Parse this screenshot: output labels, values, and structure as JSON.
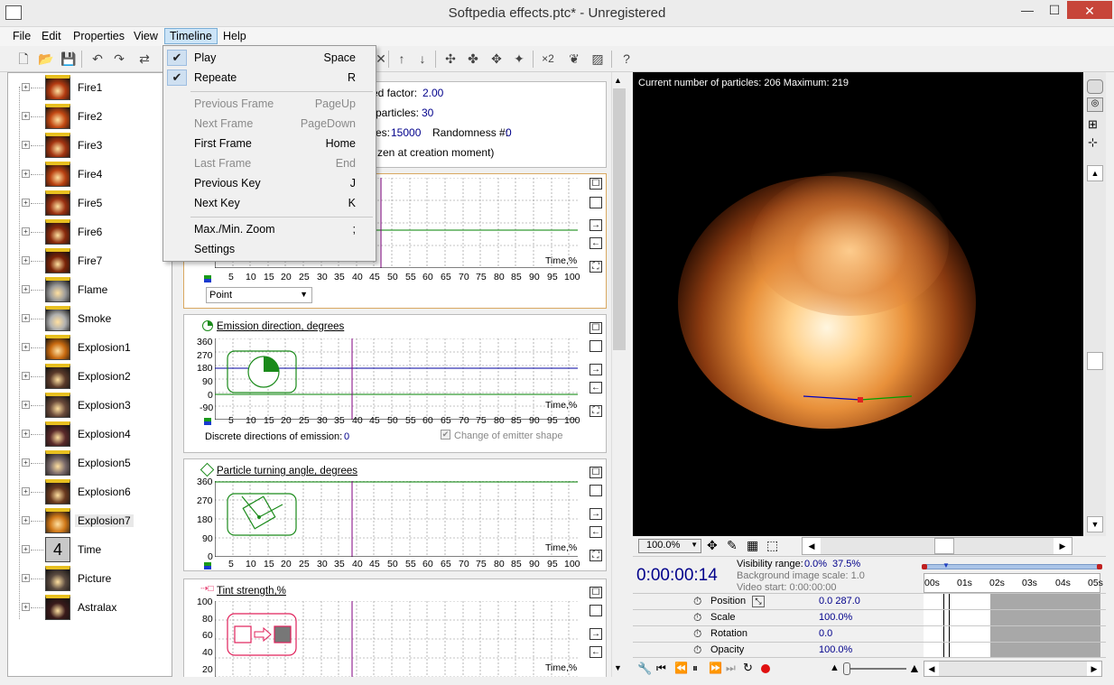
{
  "window": {
    "title": "Softpedia effects.ptc* - Unregistered",
    "minimize": "—",
    "maximize": "☐",
    "close": "✕"
  },
  "menubar": [
    "File",
    "Edit",
    "Properties",
    "View",
    "Timeline",
    "Help"
  ],
  "timeline_menu": [
    {
      "label": "Play",
      "shortcut": "Space",
      "checked": true
    },
    {
      "label": "Repeate",
      "shortcut": "R",
      "checked": true
    },
    {
      "label": "Previous Frame",
      "shortcut": "PageUp",
      "disabled": true
    },
    {
      "label": "Next Frame",
      "shortcut": "PageDown",
      "disabled": true
    },
    {
      "label": "First Frame",
      "shortcut": "Home"
    },
    {
      "label": "Last Frame",
      "shortcut": "End",
      "disabled": true
    },
    {
      "label": "Previous Key",
      "shortcut": "J"
    },
    {
      "label": "Next Key",
      "shortcut": "K"
    },
    {
      "label": "Max./Min. Zoom",
      "shortcut": ";"
    },
    {
      "label": "Settings",
      "shortcut": ""
    }
  ],
  "tree": [
    {
      "label": "Fire1",
      "color": "#b33a10"
    },
    {
      "label": "Fire2",
      "color": "#c24812"
    },
    {
      "label": "Fire3",
      "color": "#a33410"
    },
    {
      "label": "Fire4",
      "color": "#b84010"
    },
    {
      "label": "Fire5",
      "color": "#9a3010"
    },
    {
      "label": "Fire6",
      "color": "#8a2a0c"
    },
    {
      "label": "Fire7",
      "color": "#7a2408"
    },
    {
      "label": "Flame",
      "color": "#9a9a9a"
    },
    {
      "label": "Smoke",
      "color": "#b0b0b0"
    },
    {
      "label": "Explosion1",
      "color": "#c86a10"
    },
    {
      "label": "Explosion2",
      "color": "#5a3a2a"
    },
    {
      "label": "Explosion3",
      "color": "#6a4a3a"
    },
    {
      "label": "Explosion4",
      "color": "#5a2a2a"
    },
    {
      "label": "Explosion5",
      "color": "#7a6a6a"
    },
    {
      "label": "Explosion6",
      "color": "#6a3a20"
    },
    {
      "label": "Explosion7",
      "color": "#d07818"
    },
    {
      "label": "Time",
      "color": "#c8c8c8",
      "glyph": "4"
    },
    {
      "label": "Picture",
      "color": "#5a4a40"
    },
    {
      "label": "Astralax",
      "color": "#3a1a1a"
    }
  ],
  "props": {
    "speed_label": "ed factor:",
    "speed_value": "2.00",
    "particles_label": "particles:",
    "particles_value": "30",
    "es_label": "es:",
    "es_value": "15000",
    "randomness_label": "Randomness #:",
    "randomness_value": "0",
    "frozen_text": "zen at creation moment)"
  },
  "graph_x_ticks": [
    "5",
    "10",
    "15",
    "20",
    "25",
    "30",
    "35",
    "40",
    "45",
    "50",
    "55",
    "60",
    "65",
    "70",
    "75",
    "80",
    "85",
    "90",
    "95",
    "100"
  ],
  "graph_x_label": "Time,%",
  "shape_select": "Point",
  "emission": {
    "title": "Emission direction, degrees",
    "yticks": [
      "360",
      "270",
      "180",
      "90",
      "0",
      "-90"
    ],
    "discrete_label": "Discrete directions of emission:",
    "discrete_value": "0",
    "change_shape": "Change of emitter shape"
  },
  "turning": {
    "title": "Particle turning angle, degrees",
    "yticks": [
      "360",
      "270",
      "180",
      "90",
      "0"
    ]
  },
  "tint": {
    "title": "Tint strength,%",
    "yticks": [
      "100",
      "80",
      "60",
      "40",
      "20"
    ]
  },
  "view": {
    "info": "Current number of particles: 206    Maximum: 219",
    "zoom": "100.0%"
  },
  "timeline": {
    "time": "0:00:00:14",
    "visibility_label": "Visibility range:",
    "visibility_a": "0.0%",
    "visibility_b": "37.5%",
    "bg_scale": "Background image scale: 1.0",
    "video_start": "Video start: 0:00:00:00",
    "ruler": [
      "00s",
      "01s",
      "02s",
      "03s",
      "04s",
      "05s"
    ],
    "rows": [
      {
        "label": "Position",
        "value": "0.0   287.0"
      },
      {
        "label": "Scale",
        "value": "100.0%"
      },
      {
        "label": "Rotation",
        "value": "0.0"
      },
      {
        "label": "Opacity",
        "value": "100.0%"
      }
    ]
  },
  "colors": {
    "accent": "#00008b",
    "graph_green": "#008000",
    "graph_blue": "#0000a0",
    "tint": "#e0205a",
    "highlight": "#cce4f7"
  }
}
